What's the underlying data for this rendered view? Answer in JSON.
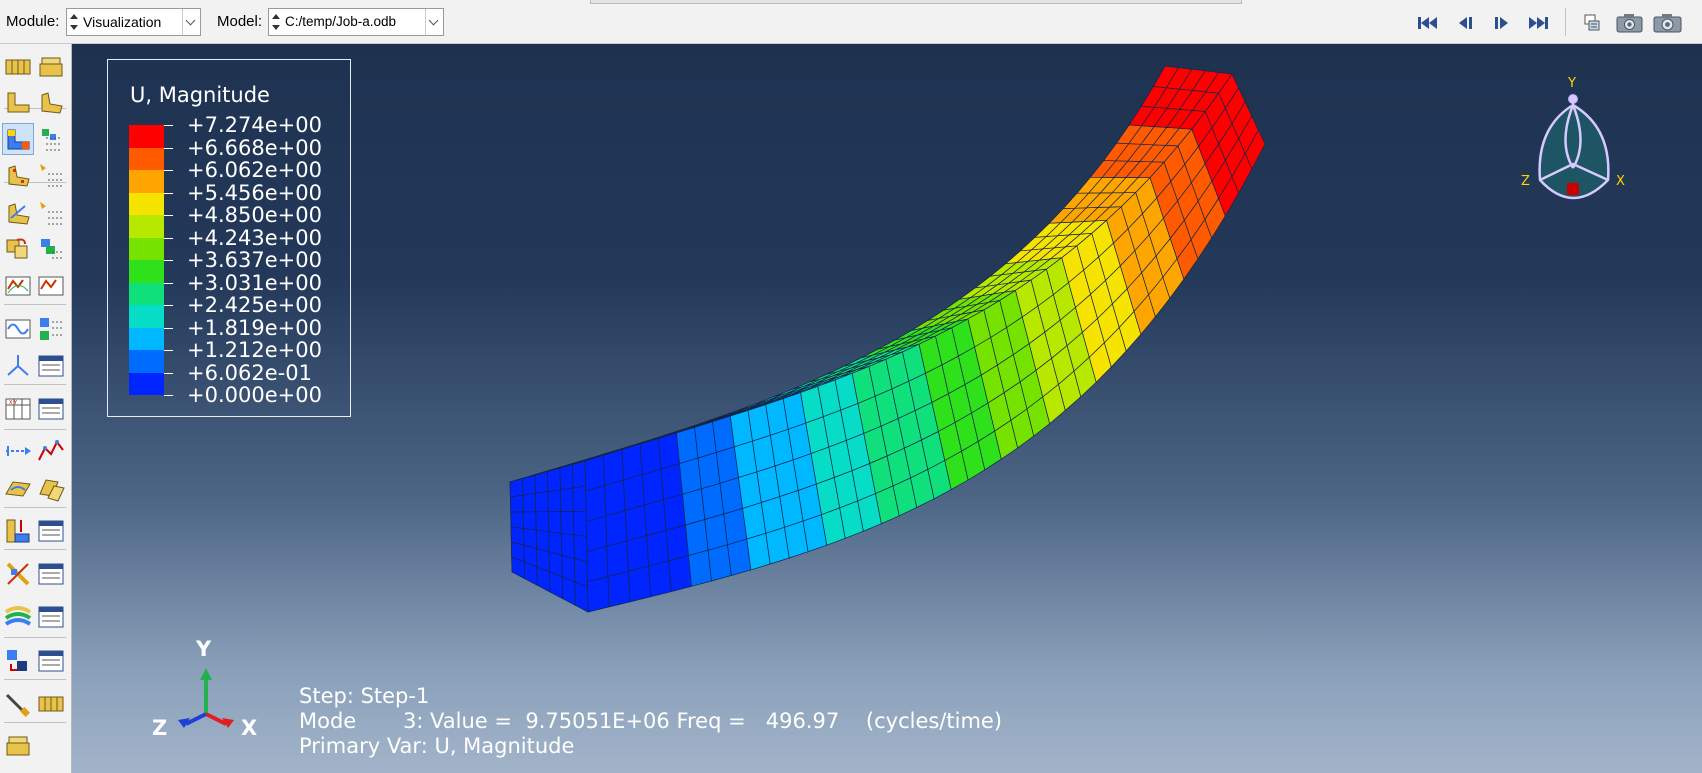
{
  "context_bar": {
    "module_label": "Module:",
    "module_value": "Visualization",
    "model_label": "Model:",
    "model_value": "C:/temp/Job-a.odb",
    "animation_icons": [
      "first-frame-icon",
      "previous-frame-icon",
      "next-frame-icon",
      "last-frame-icon"
    ],
    "right_icons": [
      "frame-selector-icon",
      "animate-time-history-icon",
      "animate-scale-factor-icon"
    ]
  },
  "toolbox": {
    "icons": [
      [
        "plot-undeformed-shape-icon",
        "plot-deformed-shape-icon"
      ],
      [
        "plot-contours-undeformed-icon",
        "common-plot-options-icon"
      ],
      [
        "plot-contours-on-deformed-icon",
        "plot-contours-on-both-icon"
      ],
      [
        "plot-symbols-icon",
        "symbol-options-icon"
      ],
      [
        "plot-material-orientations-icon",
        "material-orientation-options-icon"
      ],
      [
        "plot-allow-multiple-icon",
        "superimpose-options-icon"
      ],
      [
        "overlay-plot-icon",
        "viewport-layer-icon"
      ],
      [
        "animate-scale-factor-icon",
        "animate-time-history-icon"
      ],
      [
        "animate-harmonic-icon",
        "animation-options-icon"
      ],
      [
        "view-cut-manager-icon",
        "view-cut-options-icon"
      ],
      [
        "xy-data-manager-icon",
        "create-xy-data-icon"
      ],
      [
        "path-manager-icon",
        "xy-plot-icon"
      ],
      [
        "display-group-icon",
        "display-group-manager-icon"
      ],
      [
        "stream-manager-icon",
        "stream-options-icon"
      ],
      [
        "free-body-cut-icon",
        "free-body-options-icon"
      ],
      [
        "contour-options-icon",
        "contour-plot-options-icon"
      ],
      [
        "result-options-icon",
        "result-manager-icon"
      ],
      [
        "query-tool-icon"
      ]
    ]
  },
  "legend": {
    "title": "U, Magnitude",
    "values": [
      "+7.274e+00",
      "+6.668e+00",
      "+6.062e+00",
      "+5.456e+00",
      "+4.850e+00",
      "+4.243e+00",
      "+3.637e+00",
      "+3.031e+00",
      "+2.425e+00",
      "+1.819e+00",
      "+1.212e+00",
      "+6.062e-01",
      "+0.000e+00"
    ],
    "colors": [
      "#ff0000",
      "#ff5a00",
      "#ffa500",
      "#f7e300",
      "#b9e800",
      "#75e200",
      "#2ee11a",
      "#10e07b",
      "#07dcc7",
      "#00b8ff",
      "#006cff",
      "#0025ff"
    ]
  },
  "status": {
    "step_line": "Step: Step-1",
    "mode_line": "Mode       3: Value =  9.75051E+06 Freq =   496.97    (cycles/time)",
    "primary_var_line": "Primary Var: U, Magnitude"
  },
  "triad": {
    "x": "X",
    "y": "Y",
    "z": "Z"
  },
  "view_cube": {
    "x": "X",
    "y": "Y",
    "z": "Z"
  }
}
